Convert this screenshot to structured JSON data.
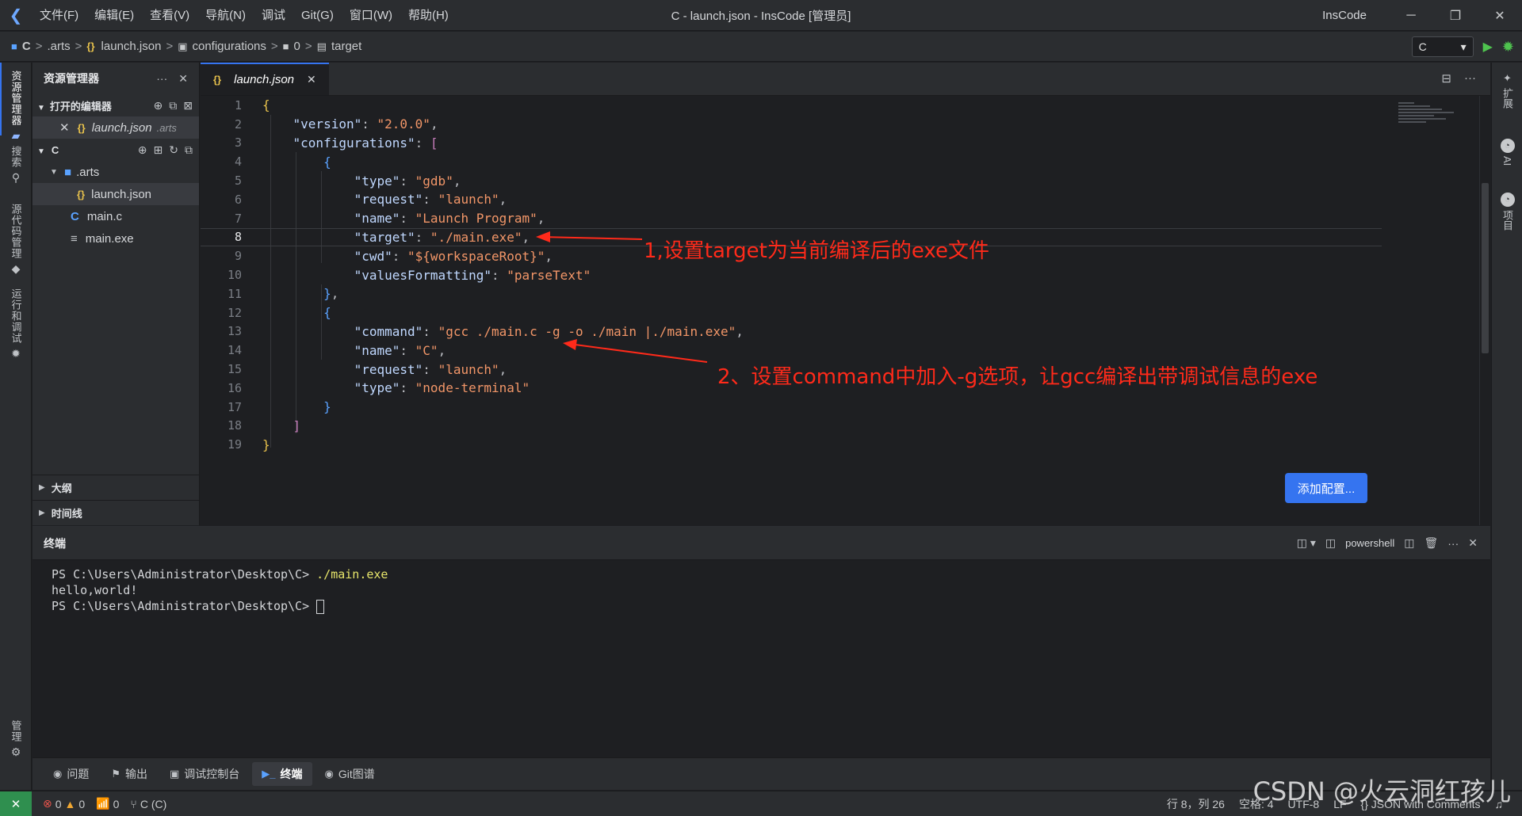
{
  "titlebar": {
    "menu": [
      "文件(F)",
      "编辑(E)",
      "查看(V)",
      "导航(N)",
      "调试",
      "Git(G)",
      "窗口(W)",
      "帮助(H)"
    ],
    "window_title": "C - launch.json - InsCode [管理员]",
    "brand": "InsCode"
  },
  "breadcrumb": {
    "items": [
      "C",
      ".arts",
      "launch.json",
      "configurations",
      "0",
      "target"
    ],
    "run_target": "C"
  },
  "activity": {
    "explorer": "资源管理器",
    "search": "搜索",
    "scm": "源代码管理",
    "debug": "运行和调试",
    "manage": "管理"
  },
  "explorer": {
    "title": "资源管理器",
    "open_editors": "打开的编辑器",
    "open_file": "launch.json",
    "open_file_dir": ".arts",
    "root": "C",
    "folder": ".arts",
    "files": [
      "launch.json",
      "main.c",
      "main.exe"
    ],
    "outline": "大纲",
    "timeline": "时间线"
  },
  "editor": {
    "tab": "launch.json",
    "line_numbers": [
      "1",
      "2",
      "3",
      "4",
      "5",
      "6",
      "7",
      "8",
      "9",
      "10",
      "11",
      "12",
      "13",
      "14",
      "15",
      "16",
      "17",
      "18",
      "19"
    ],
    "lines": {
      "l2_key": "\"version\"",
      "l2_val": "\"2.0.0\"",
      "l3_key": "\"configurations\"",
      "l5_key": "\"type\"",
      "l5_val": "\"gdb\"",
      "l6_key": "\"request\"",
      "l6_val": "\"launch\"",
      "l7_key": "\"name\"",
      "l7_val": "\"Launch Program\"",
      "l8_key": "\"target\"",
      "l8_val": "\"./main.exe\"",
      "l9_key": "\"cwd\"",
      "l9_val": "\"${workspaceRoot}\"",
      "l10_key": "\"valuesFormatting\"",
      "l10_val": "\"parseText\"",
      "l13_key": "\"command\"",
      "l13_val": "\"gcc ./main.c -g -o ./main |./main.exe\"",
      "l14_key": "\"name\"",
      "l14_val": "\"C\"",
      "l15_key": "\"request\"",
      "l15_val": "\"launch\"",
      "l16_key": "\"type\"",
      "l16_val": "\"node-terminal\""
    },
    "add_config": "添加配置..."
  },
  "annotations": {
    "a1": "1,设置target为当前编译后的exe文件",
    "a2": "2、设置command中加入-g选项，让gcc编译出带调试信息的exe"
  },
  "right_bar": {
    "extensions": "扩展",
    "ai": "AI",
    "project": "项目"
  },
  "panel": {
    "title": "终端",
    "shell": "powershell",
    "term_prompt1": "PS C:\\Users\\Administrator\\Desktop\\C> ",
    "term_cmd1": "./main.exe",
    "term_out1": "hello,world!",
    "term_prompt2": "PS C:\\Users\\Administrator\\Desktop\\C> "
  },
  "bottom_tabs": [
    "问题",
    "输出",
    "调试控制台",
    "终端",
    "Git图谱"
  ],
  "status": {
    "errors": "0",
    "warnings": "0",
    "ports": "0",
    "branch": "C (C)",
    "position": "行 8，列 26",
    "spaces": "空格: 4",
    "encoding": "UTF-8",
    "eol": "LF",
    "language": "JSON with Comments"
  },
  "watermark": "CSDN @火云洞红孩儿",
  "colors": {
    "accent": "#3574f0",
    "annotation": "#ff2a1a",
    "run_green": "#4fc34f"
  }
}
